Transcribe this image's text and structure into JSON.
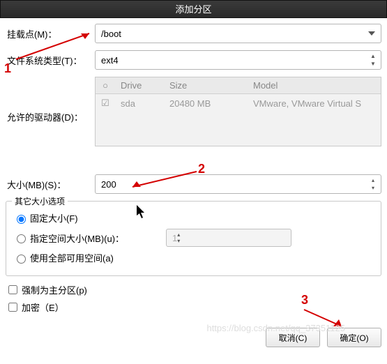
{
  "title": "添加分区",
  "labels": {
    "mount": "挂载点(M)：",
    "fstype": "文件系统类型(T)：",
    "drives": "允许的驱动器(D)：",
    "size": "大小(MB)(S)：",
    "other": "其它大小选项",
    "fixed": "固定大小(F)",
    "specify": "指定空间大小(MB)(u)：",
    "fill": "使用全部可用空间(a)",
    "force_primary": "强制为主分区(p)",
    "encrypt": "加密（E）",
    "cancel": "取消(C)",
    "ok": "确定(O)"
  },
  "fields": {
    "mount_value": "/boot",
    "fstype_value": "ext4",
    "size_value": "200",
    "specify_value": "1"
  },
  "drive_table": {
    "headers": {
      "chk": "",
      "drive": "Drive",
      "size": "Size",
      "model": "Model"
    },
    "row": {
      "drive": "sda",
      "size": "20480 MB",
      "model": "VMware, VMware Virtual S"
    }
  },
  "annotations": {
    "n1": "1",
    "n2": "2",
    "n3": "3"
  },
  "watermark": "https://blog.csdn.net/qq_37351125"
}
